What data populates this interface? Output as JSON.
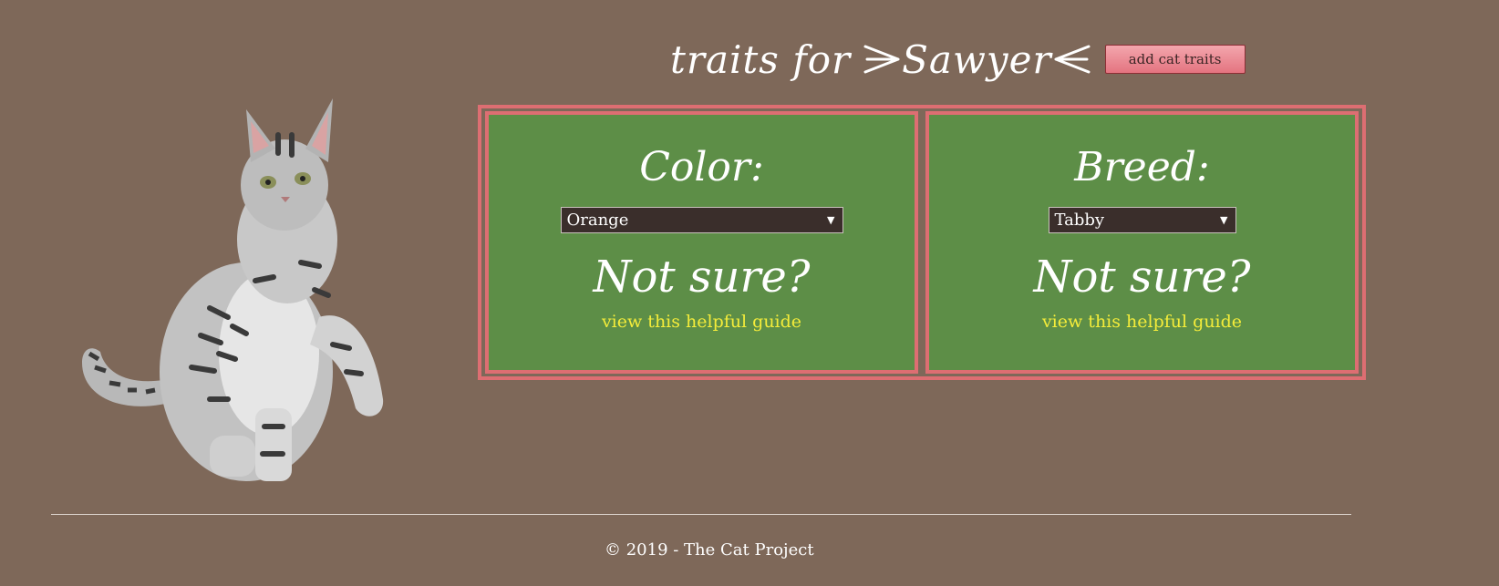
{
  "header": {
    "title_prefix": "traits for",
    "cat_name": "Sawyer",
    "add_button_label": "add cat traits"
  },
  "color_card": {
    "title": "Color:",
    "selected": "Orange",
    "not_sure": "Not sure?",
    "guide_link": "view this helpful guide"
  },
  "breed_card": {
    "title": "Breed:",
    "selected": "Tabby",
    "not_sure": "Not sure?",
    "guide_link": "view this helpful guide"
  },
  "footer": {
    "text": "© 2019 - The Cat Project"
  },
  "colors": {
    "background": "#7e6859",
    "card": "#5d8e47",
    "border": "#dd6e72",
    "link": "#f4ec3a",
    "button": "#e47480"
  }
}
